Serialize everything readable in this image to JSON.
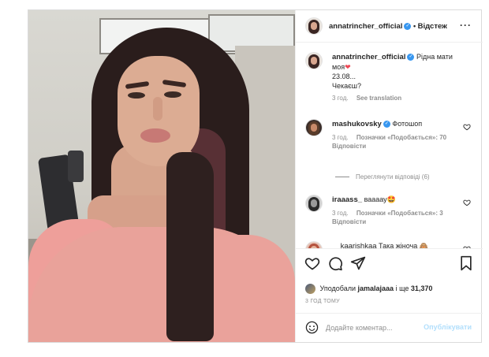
{
  "post": {
    "image_alt": "photo",
    "header": {
      "username": "annatrincher_official",
      "follow_label": "Відстеж",
      "more_icon": "more-horizontal-icon"
    },
    "caption": {
      "username": "annatrincher_official",
      "text": "Рідна мати моя",
      "line2": "23.08...",
      "line3": "Чекаєш?",
      "time": "3 год.",
      "translate_label": "See translation"
    },
    "comments": [
      {
        "username": "mashukovsky",
        "verified": true,
        "text": "Фотошоп",
        "time": "3 год.",
        "likes": "Позначки «Подобається»: 70",
        "reply_label": "Відповісти",
        "view_replies": "Переглянути відповіді (6)"
      },
      {
        "username": "iraaass_",
        "verified": false,
        "text": "ваааау🤩",
        "time": "3 год.",
        "likes": "Позначки «Подобається»: 3",
        "reply_label": "Відповісти"
      },
      {
        "username": "__kaarishkaa",
        "verified": false,
        "text": "Така жіноча 🙈"
      }
    ],
    "actions": {
      "like_icon": "heart-icon",
      "comment_icon": "comment-icon",
      "share_icon": "send-icon",
      "save_icon": "bookmark-icon"
    },
    "likes": {
      "prefix": "Уподобали",
      "user": "jamalajaaa",
      "middle": "і ще",
      "count": "31,370"
    },
    "time_ago": "3 ГОД ТОМУ",
    "add_comment": {
      "placeholder": "Додайте коментар...",
      "post_label": "Опублікувати",
      "emoji_icon": "emoji-smile-icon"
    }
  },
  "colors": {
    "verified": "#3897f0",
    "heart": "#ed4956",
    "muted": "#8e8e8e",
    "post_disabled": "#b2dffc"
  }
}
